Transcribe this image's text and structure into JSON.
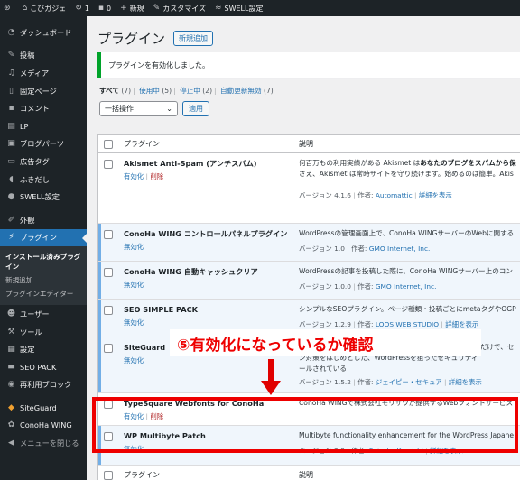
{
  "adminbar": {
    "site_name": "こびガジェ",
    "updates_count": "1",
    "comments_count": "0",
    "new_label": "新規",
    "customize_label": "カスタマイズ",
    "swell_settings_label": "SWELL設定"
  },
  "sidebar": {
    "items": [
      {
        "label": "ダッシュボード"
      },
      {
        "label": "投稿"
      },
      {
        "label": "メディア"
      },
      {
        "label": "固定ページ"
      },
      {
        "label": "コメント"
      },
      {
        "label": "LP"
      },
      {
        "label": "ブログパーツ"
      },
      {
        "label": "広告タグ"
      },
      {
        "label": "ふきだし"
      },
      {
        "label": "SWELL設定"
      },
      {
        "label": "外観"
      },
      {
        "label": "プラグイン"
      },
      {
        "label": "ユーザー"
      },
      {
        "label": "ツール"
      },
      {
        "label": "設定"
      },
      {
        "label": "SEO PACK"
      },
      {
        "label": "再利用ブロック"
      },
      {
        "label": "SiteGuard"
      },
      {
        "label": "ConoHa WING"
      },
      {
        "label": "メニューを閉じる"
      }
    ],
    "submenu": [
      {
        "label": "インストール済みプラグイン"
      },
      {
        "label": "新規追加"
      },
      {
        "label": "プラグインエディター"
      }
    ]
  },
  "main": {
    "title": "プラグイン",
    "add_new_label": "新規追加",
    "notice": "プラグインを有効化しました。",
    "filters": [
      {
        "label": "すべて",
        "count": "(7)"
      },
      {
        "label": "使用中",
        "count": "(5)"
      },
      {
        "label": "停止中",
        "count": "(2)"
      },
      {
        "label": "自動更新無効",
        "count": "(7)"
      }
    ],
    "bulk_action": "一括操作",
    "apply_label": "適用",
    "col_plugin": "プラグイン",
    "col_description": "説明",
    "plugins": [
      {
        "name": "Akismet Anti-Spam (アンチスパム)",
        "action1": "有効化",
        "action2": "削除",
        "desc1a": "何百万もの利用実績がある Akismet は",
        "desc1b": "あなたのブログをスパムから保",
        "desc2": "さえ、Akismet は常時サイトを守り続けます。始めるのは簡単。Akis",
        "version": "バージョン 4.1.6",
        "author_label": "作者:",
        "author": "Automattic",
        "details": "詳細を表示"
      },
      {
        "name": "ConoHa WING コントロールパネルプラグイン",
        "action1": "無効化",
        "desc1a": "WordPressの管理画面上で、ConoHa WINGサーバーのWebに関する",
        "version": "バージョン 1.0",
        "author_label": "作者:",
        "author": "GMO Internet, Inc."
      },
      {
        "name": "ConoHa WING 自動キャッシュクリア",
        "action1": "無効化",
        "desc1a": "WordPressの記事を投稿した際に、ConoHa WINGサーバー上のコン",
        "version": "バージョン 1.0.0",
        "author_label": "作者:",
        "author": "GMO Internet, Inc."
      },
      {
        "name": "SEO SIMPLE PACK",
        "action1": "無効化",
        "desc1a": "シンプルなSEOプラグイン。ページ種類・投稿ごとにmetaタグやOGP",
        "version": "バージョン 1.2.9",
        "author_label": "作者:",
        "author": "LOOS WEB STUDIO",
        "details": "詳細を表示"
      },
      {
        "name": "SiteGuard",
        "action1": "無効化",
        "desc1a": "SiteGuard WP Pluginは、WordPressにインストールするだけで、セ",
        "desc2": "ン対策をはじめとした、WordPressを狙ったセキュリティ",
        "desc3": "ールされている",
        "version": "バージョン 1.5.2",
        "author_label": "作者:",
        "author": "ジェイピー・セキュア",
        "details": "詳細を表示"
      },
      {
        "name": "TypeSquare Webfonts for ConoHa",
        "action1": "有効化",
        "action2": "削除",
        "desc1a": "ConoHa WINGで株式会社モリサワが提供するWebフォントサービス"
      },
      {
        "name": "WP Multibyte Patch",
        "action1": "無効化",
        "desc1a": "Multibyte functionality enhancement for the WordPress Japane",
        "version": "バージョン 2.9",
        "author_label": "作者:",
        "author": "Seisuke Kuraishi",
        "details": "詳細を表示"
      }
    ]
  },
  "annotation": {
    "callout": "⑤有効化になっているか確認",
    "color": "#e00000"
  }
}
